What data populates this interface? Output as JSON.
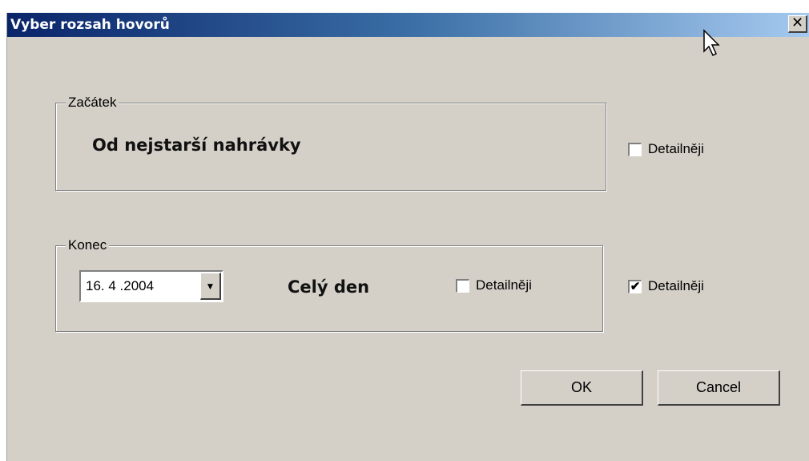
{
  "window": {
    "title": "Vyber rozsah hovorů",
    "close_glyph": "✕"
  },
  "start_group": {
    "legend": "Začátek",
    "value_text": "Od nejstarší nahrávky",
    "detail_checkbox": {
      "label": "Detailněji",
      "checked": false
    }
  },
  "end_group": {
    "legend": "Konec",
    "date_value": "16. 4 .2004",
    "range_text": "Celý den",
    "inner_detail_checkbox": {
      "label": "Detailněji",
      "checked": false
    },
    "detail_checkbox": {
      "label": "Detailněji",
      "checked": true
    }
  },
  "buttons": {
    "ok": "OK",
    "cancel": "Cancel"
  },
  "icons": {
    "dropdown": "▼",
    "check": "✔",
    "cursor": "mouse-pointer-icon"
  },
  "colors": {
    "dialog_bg": "#d4d0c8",
    "title_gradient_start": "#0a246a",
    "title_gradient_end": "#a6caf0"
  }
}
